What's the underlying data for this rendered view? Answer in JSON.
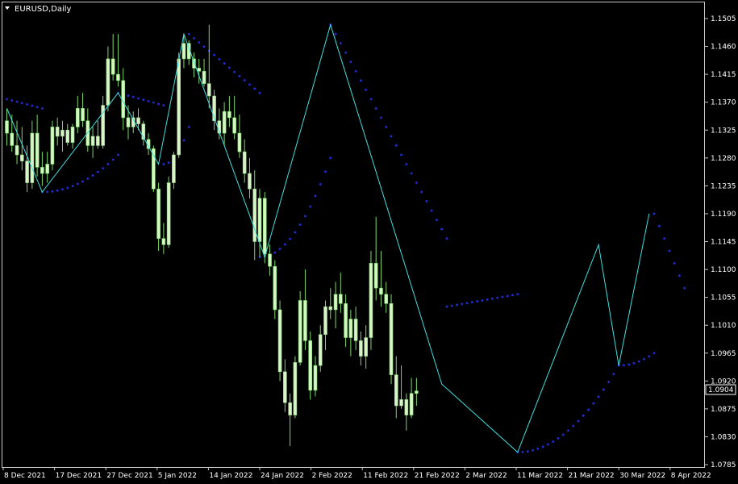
{
  "window": {
    "title": "EURUSD,Daily"
  },
  "current_price": {
    "label": "1.0904",
    "value": 1.0904
  },
  "colors": {
    "background": "#000000",
    "frame": "#c8c8c8",
    "candle_up": "#7fd66b",
    "candle_body": "#d8f5c8",
    "candle_outline": "#7fd66b",
    "zigzag": "#40e0e0",
    "sar": "#1f2fe0",
    "text": "#ffffff"
  },
  "chart_data": {
    "type": "candlestick",
    "symbol": "EURUSD",
    "timeframe": "Daily",
    "ylim": [
      1.0785,
      1.1505
    ],
    "y_ticks": [
      "1.1505",
      "1.1460",
      "1.1415",
      "1.1370",
      "1.1325",
      "1.1280",
      "1.1235",
      "1.1190",
      "1.1145",
      "1.1100",
      "1.1055",
      "1.1010",
      "1.0965",
      "1.0920",
      "1.0875",
      "1.0830",
      "1.0785"
    ],
    "x_ticks": [
      "8 Dec 2021",
      "17 Dec 2021",
      "27 Dec 2021",
      "5 Jan 2022",
      "14 Jan 2022",
      "24 Jan 2022",
      "2 Feb 2022",
      "11 Feb 2022",
      "21 Feb 2022",
      "2 Mar 2022",
      "11 Mar 2022",
      "21 Mar 2022",
      "30 Mar 2022",
      "8 Apr 2022"
    ],
    "candles": [
      {
        "o": 1.134,
        "h": 1.136,
        "l": 1.13,
        "c": 1.132
      },
      {
        "o": 1.132,
        "h": 1.135,
        "l": 1.129,
        "c": 1.13
      },
      {
        "o": 1.13,
        "h": 1.134,
        "l": 1.127,
        "c": 1.1285
      },
      {
        "o": 1.1285,
        "h": 1.133,
        "l": 1.126,
        "c": 1.1275
      },
      {
        "o": 1.1275,
        "h": 1.13,
        "l": 1.1225,
        "c": 1.124
      },
      {
        "o": 1.124,
        "h": 1.134,
        "l": 1.123,
        "c": 1.132
      },
      {
        "o": 1.132,
        "h": 1.135,
        "l": 1.125,
        "c": 1.1265
      },
      {
        "o": 1.1265,
        "h": 1.129,
        "l": 1.1235,
        "c": 1.1255
      },
      {
        "o": 1.1255,
        "h": 1.129,
        "l": 1.124,
        "c": 1.127
      },
      {
        "o": 1.127,
        "h": 1.134,
        "l": 1.126,
        "c": 1.133
      },
      {
        "o": 1.133,
        "h": 1.1345,
        "l": 1.13,
        "c": 1.1315
      },
      {
        "o": 1.1315,
        "h": 1.134,
        "l": 1.129,
        "c": 1.1325
      },
      {
        "o": 1.1325,
        "h": 1.1335,
        "l": 1.13,
        "c": 1.1305
      },
      {
        "o": 1.1305,
        "h": 1.1335,
        "l": 1.1295,
        "c": 1.133
      },
      {
        "o": 1.133,
        "h": 1.138,
        "l": 1.132,
        "c": 1.136
      },
      {
        "o": 1.136,
        "h": 1.1385,
        "l": 1.133,
        "c": 1.134
      },
      {
        "o": 1.134,
        "h": 1.136,
        "l": 1.129,
        "c": 1.13
      },
      {
        "o": 1.13,
        "h": 1.133,
        "l": 1.128,
        "c": 1.1315
      },
      {
        "o": 1.1315,
        "h": 1.134,
        "l": 1.1295,
        "c": 1.13
      },
      {
        "o": 1.13,
        "h": 1.138,
        "l": 1.1295,
        "c": 1.1365
      },
      {
        "o": 1.1365,
        "h": 1.146,
        "l": 1.1355,
        "c": 1.144
      },
      {
        "o": 1.144,
        "h": 1.148,
        "l": 1.1405,
        "c": 1.1415
      },
      {
        "o": 1.1415,
        "h": 1.148,
        "l": 1.1395,
        "c": 1.1405
      },
      {
        "o": 1.1405,
        "h": 1.1425,
        "l": 1.1325,
        "c": 1.1345
      },
      {
        "o": 1.1345,
        "h": 1.1365,
        "l": 1.131,
        "c": 1.133
      },
      {
        "o": 1.133,
        "h": 1.1355,
        "l": 1.132,
        "c": 1.1345
      },
      {
        "o": 1.1345,
        "h": 1.136,
        "l": 1.1325,
        "c": 1.1335
      },
      {
        "o": 1.1335,
        "h": 1.134,
        "l": 1.13,
        "c": 1.131
      },
      {
        "o": 1.131,
        "h": 1.132,
        "l": 1.1285,
        "c": 1.1295
      },
      {
        "o": 1.1295,
        "h": 1.13,
        "l": 1.1225,
        "c": 1.123
      },
      {
        "o": 1.123,
        "h": 1.124,
        "l": 1.113,
        "c": 1.115
      },
      {
        "o": 1.115,
        "h": 1.1175,
        "l": 1.1125,
        "c": 1.114
      },
      {
        "o": 1.114,
        "h": 1.125,
        "l": 1.1135,
        "c": 1.124
      },
      {
        "o": 1.124,
        "h": 1.129,
        "l": 1.123,
        "c": 1.1285
      },
      {
        "o": 1.1285,
        "h": 1.145,
        "l": 1.128,
        "c": 1.144
      },
      {
        "o": 1.144,
        "h": 1.148,
        "l": 1.1425,
        "c": 1.1465
      },
      {
        "o": 1.1465,
        "h": 1.147,
        "l": 1.143,
        "c": 1.144
      },
      {
        "o": 1.144,
        "h": 1.145,
        "l": 1.141,
        "c": 1.1425
      },
      {
        "o": 1.1425,
        "h": 1.144,
        "l": 1.14,
        "c": 1.142
      },
      {
        "o": 1.142,
        "h": 1.144,
        "l": 1.1395,
        "c": 1.14
      },
      {
        "o": 1.14,
        "h": 1.1495,
        "l": 1.136,
        "c": 1.138
      },
      {
        "o": 1.138,
        "h": 1.139,
        "l": 1.1325,
        "c": 1.134
      },
      {
        "o": 1.134,
        "h": 1.136,
        "l": 1.131,
        "c": 1.132
      },
      {
        "o": 1.132,
        "h": 1.137,
        "l": 1.13,
        "c": 1.1355
      },
      {
        "o": 1.1355,
        "h": 1.138,
        "l": 1.133,
        "c": 1.1345
      },
      {
        "o": 1.1345,
        "h": 1.138,
        "l": 1.131,
        "c": 1.132
      },
      {
        "o": 1.132,
        "h": 1.135,
        "l": 1.128,
        "c": 1.129
      },
      {
        "o": 1.129,
        "h": 1.131,
        "l": 1.124,
        "c": 1.1255
      },
      {
        "o": 1.1255,
        "h": 1.128,
        "l": 1.1215,
        "c": 1.123
      },
      {
        "o": 1.123,
        "h": 1.126,
        "l": 1.1115,
        "c": 1.1145
      },
      {
        "o": 1.1145,
        "h": 1.123,
        "l": 1.112,
        "c": 1.1215
      },
      {
        "o": 1.1215,
        "h": 1.1225,
        "l": 1.111,
        "c": 1.1125
      },
      {
        "o": 1.1125,
        "h": 1.114,
        "l": 1.109,
        "c": 1.1105
      },
      {
        "o": 1.1105,
        "h": 1.1115,
        "l": 1.102,
        "c": 1.1035
      },
      {
        "o": 1.1035,
        "h": 1.105,
        "l": 1.092,
        "c": 1.0935
      },
      {
        "o": 1.0935,
        "h": 1.0955,
        "l": 1.087,
        "c": 1.0885
      },
      {
        "o": 1.0885,
        "h": 1.09,
        "l": 1.0815,
        "c": 1.0865
      },
      {
        "o": 1.0865,
        "h": 1.096,
        "l": 1.086,
        "c": 1.095
      },
      {
        "o": 1.095,
        "h": 1.1065,
        "l": 1.0945,
        "c": 1.105
      },
      {
        "o": 1.105,
        "h": 1.11,
        "l": 1.097,
        "c": 1.0985
      },
      {
        "o": 1.0985,
        "h": 1.1,
        "l": 1.089,
        "c": 1.0905
      },
      {
        "o": 1.0905,
        "h": 1.096,
        "l": 1.0895,
        "c": 1.0945
      },
      {
        "o": 1.0945,
        "h": 1.101,
        "l": 1.0935,
        "c": 1.0995
      },
      {
        "o": 1.0995,
        "h": 1.105,
        "l": 1.097,
        "c": 1.104
      },
      {
        "o": 1.104,
        "h": 1.107,
        "l": 1.102,
        "c": 1.1035
      },
      {
        "o": 1.1035,
        "h": 1.108,
        "l": 1.1005,
        "c": 1.106
      },
      {
        "o": 1.106,
        "h": 1.1095,
        "l": 1.103,
        "c": 1.1045
      },
      {
        "o": 1.1045,
        "h": 1.106,
        "l": 1.0975,
        "c": 1.099
      },
      {
        "o": 1.099,
        "h": 1.1035,
        "l": 1.096,
        "c": 1.102
      },
      {
        "o": 1.102,
        "h": 1.104,
        "l": 1.097,
        "c": 1.0985
      },
      {
        "o": 1.0985,
        "h": 1.1,
        "l": 1.0945,
        "c": 1.096
      },
      {
        "o": 1.096,
        "h": 1.101,
        "l": 1.094,
        "c": 1.099
      },
      {
        "o": 1.099,
        "h": 1.113,
        "l": 1.097,
        "c": 1.111
      },
      {
        "o": 1.111,
        "h": 1.1185,
        "l": 1.105,
        "c": 1.107
      },
      {
        "o": 1.107,
        "h": 1.113,
        "l": 1.104,
        "c": 1.106
      },
      {
        "o": 1.106,
        "h": 1.108,
        "l": 1.103,
        "c": 1.1045
      },
      {
        "o": 1.1045,
        "h": 1.106,
        "l": 1.0915,
        "c": 1.093
      },
      {
        "o": 1.093,
        "h": 1.096,
        "l": 1.086,
        "c": 1.088
      },
      {
        "o": 1.088,
        "h": 1.0945,
        "l": 1.0875,
        "c": 1.089
      },
      {
        "o": 1.089,
        "h": 1.09,
        "l": 1.084,
        "c": 1.0865
      },
      {
        "o": 1.0865,
        "h": 1.0925,
        "l": 1.086,
        "c": 1.09
      },
      {
        "o": 1.09,
        "h": 1.0925,
        "l": 1.088,
        "c": 1.0904
      }
    ],
    "zigzag": [
      {
        "i": 0,
        "y": 1.136
      },
      {
        "i": 7,
        "y": 1.1225
      },
      {
        "i": 22,
        "y": 1.1385
      },
      {
        "i": 30,
        "y": 1.127
      },
      {
        "i": 35,
        "y": 1.148
      },
      {
        "i": 51,
        "y": 1.112
      },
      {
        "i": 64,
        "y": 1.1495
      },
      {
        "i": 86,
        "y": 1.0915
      },
      {
        "i": 101,
        "y": 1.0805
      },
      {
        "i": 117,
        "y": 1.114
      },
      {
        "i": 121,
        "y": 1.0945
      },
      {
        "i": 127,
        "y": 1.119
      }
    ],
    "sar": [
      {
        "x0": 0,
        "x1": 7,
        "y0": 1.1375,
        "y1": 1.136,
        "dir": "down"
      },
      {
        "x0": 7,
        "x1": 22,
        "y0": 1.1225,
        "y1": 1.1285,
        "dir": "up"
      },
      {
        "x0": 22,
        "x1": 31,
        "y0": 1.1385,
        "y1": 1.1365,
        "dir": "down"
      },
      {
        "x0": 31,
        "x1": 36,
        "y0": 1.127,
        "y1": 1.133,
        "dir": "up"
      },
      {
        "x0": 36,
        "x1": 50,
        "y0": 1.148,
        "y1": 1.1385,
        "dir": "down"
      },
      {
        "x0": 50,
        "x1": 64,
        "y0": 1.112,
        "y1": 1.128,
        "dir": "up"
      },
      {
        "x0": 64,
        "x1": 87,
        "y0": 1.1495,
        "y1": 1.115,
        "dir": "down"
      },
      {
        "x0": 87,
        "x1": 101,
        "y0": 1.104,
        "y1": 1.106,
        "dir": "down"
      },
      {
        "x0": 101,
        "x1": 121,
        "y0": 1.0805,
        "y1": 1.0945,
        "dir": "up"
      },
      {
        "x0": 121,
        "x1": 128,
        "y0": 1.0945,
        "y1": 1.0965,
        "dir": "up"
      },
      {
        "x0": 128,
        "x1": 134,
        "y0": 1.119,
        "y1": 1.107,
        "dir": "down"
      }
    ]
  }
}
